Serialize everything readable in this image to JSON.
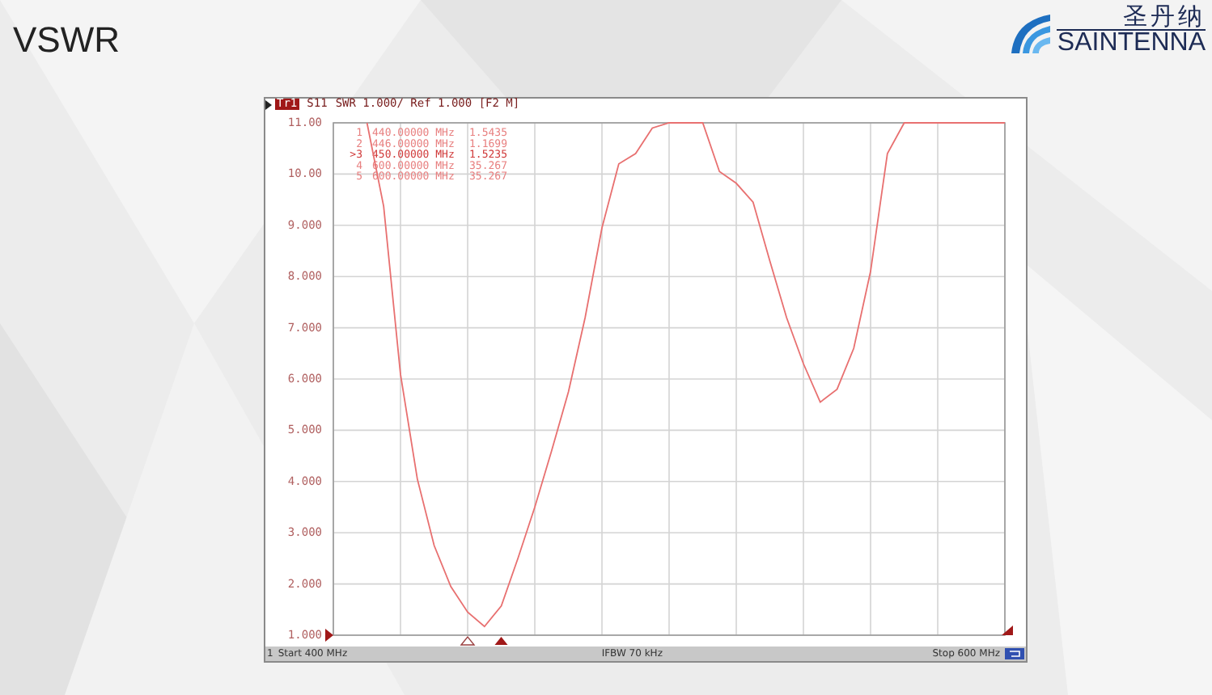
{
  "title": "VSWR",
  "logo": {
    "chinese": "圣丹纳",
    "latin": "SAINTENNA"
  },
  "analyzer": {
    "trace_badge": "Tr1",
    "trace_info": "SWR 1.000/ Ref 1.000 [F2 M]",
    "markers": [
      {
        "label": "1",
        "freq": "440.00000 MHz",
        "value": "1.5435",
        "selected": false
      },
      {
        "label": "2",
        "freq": "446.00000 MHz",
        "value": "1.1699",
        "selected": false
      },
      {
        "label": ">3",
        "freq": "450.00000 MHz",
        "value": "1.5235",
        "selected": true
      },
      {
        "label": "4",
        "freq": "600.00000 MHz",
        "value": "35.267",
        "selected": false
      },
      {
        "label": "5",
        "freq": "600.00000 MHz",
        "value": "35.267",
        "selected": false
      }
    ],
    "chart_data": {
      "type": "line",
      "grid": true,
      "ylim": [
        1,
        11
      ],
      "categories": [
        null,
        null,
        null,
        null,
        null,
        null,
        null,
        null,
        null,
        null,
        null,
        null,
        null,
        null,
        null,
        null,
        null,
        null,
        null,
        null,
        null,
        null,
        null,
        null,
        null,
        null,
        null,
        null,
        null,
        null,
        null,
        null,
        null,
        null,
        null,
        null,
        null,
        null,
        null,
        null,
        null
      ],
      "series": [
        {
          "name": "S11",
          "color": "#e87070",
          "values": [
            null,
            null,
            11,
            9.37,
            6.09,
            4.05,
            2.75,
            1.95,
            1.45,
            1.17,
            1.57,
            2.5,
            3.5,
            4.6,
            5.75,
            7.2,
            8.95,
            10.2,
            10.4,
            10.9,
            11,
            11,
            11,
            10.05,
            9.82,
            9.45,
            8.3,
            7.2,
            6.3,
            5.55,
            5.8,
            6.6,
            8.1,
            10.4,
            11,
            11,
            11,
            11,
            11,
            11,
            11
          ]
        }
      ],
      "yticks": [
        {
          "value": 11,
          "label": "11.00"
        },
        {
          "value": 10,
          "label": "10.00"
        },
        {
          "value": 9,
          "label": "9.000"
        },
        {
          "value": 8,
          "label": "8.000"
        },
        {
          "value": 7,
          "label": "7.000"
        },
        {
          "value": 6,
          "label": "6.000"
        },
        {
          "value": 5,
          "label": "5.000"
        },
        {
          "value": 4,
          "label": "4.000"
        },
        {
          "value": 3,
          "label": "3.000"
        },
        {
          "value": 2,
          "label": "2.000"
        },
        {
          "value": 1,
          "label": "1.000"
        }
      ]
    },
    "footer": {
      "channel": "1",
      "start": "Start 400 MHz",
      "ifbw": "IFBW 70 kHz",
      "stop": "Stop 600 MHz"
    }
  }
}
